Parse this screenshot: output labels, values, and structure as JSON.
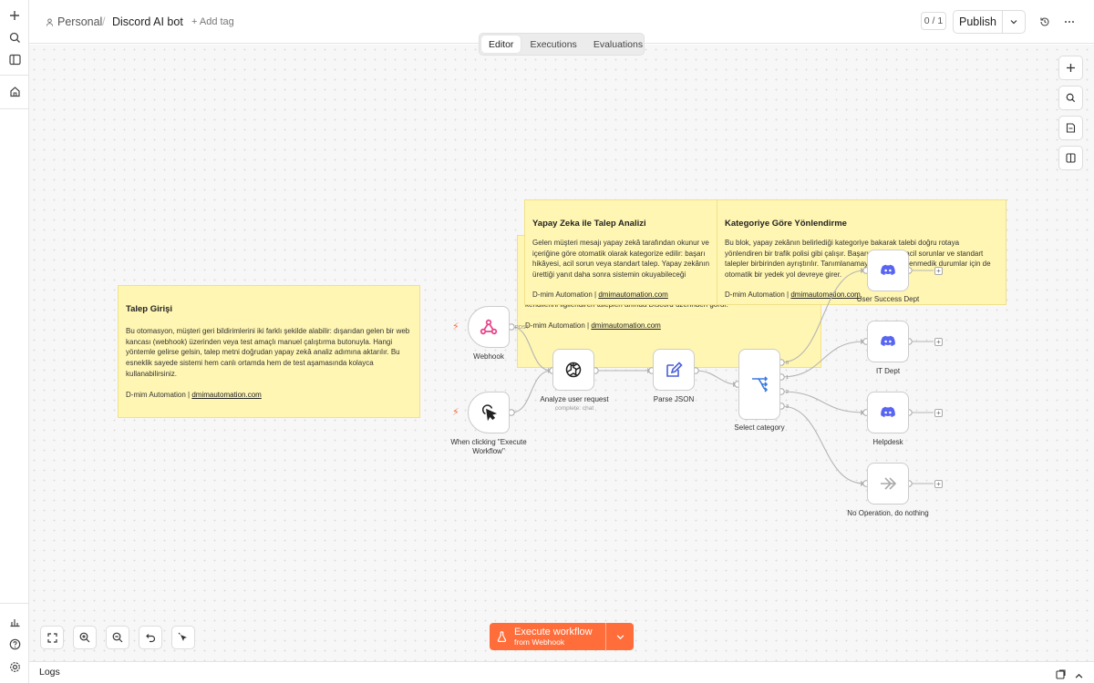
{
  "header": {
    "workspace": "Personal",
    "separator": "/",
    "workflow_name": "Discord AI bot",
    "add_tag": "+ Add tag",
    "counter": "0 / 1",
    "publish": "Publish"
  },
  "tabs": [
    "Editor",
    "Executions",
    "Evaluations"
  ],
  "sticky_notes": [
    {
      "title": "Talep Girişi",
      "body": "Bu otomasyon, müşteri geri bildirimlerini iki farklı şekilde alabilir: dışarıdan gelen bir web kancası (webhook) üzerinden veya test amaçlı manuel çalıştırma butonuyla. Hangi yöntemle gelirse gelsin, talep metni doğrudan yapay zekâ analiz adımına aktarılır. Bu esneklik sayede sistemi hem canlı ortamda hem de test aşamasında kolayca kullanabilirsiniz.",
      "footer": "D-mim Automation |",
      "link": "dmimautomation.com"
    },
    {
      "title": "Yapay Zeka ile Talep Analizi",
      "body": "Gelen müşteri mesajı yapay zekâ tarafından okunur ve içeriğine göre otomatik olarak kategorize edilir: başarı hikâyesi, acil sorun veya standart talep. Yapay zekânın ürettiği yanıt daha sonra sistemin okuyabileceği yapılandırılmış bir veriye dönüştürülür. Böylece hiçbir mesaj elle okunup sınıflandırılmak zorunda kalmaz.",
      "footer": "D-mim Automation |",
      "link": "dmimautomation.com"
    },
    {
      "title": "Kategoriye Göre Yönlendirme",
      "body": "Bu blok, yapay zekânın belirlediği kategoriye bakarak talebi doğru rotaya yönlendiren bir trafik polisi gibi çalışır. Başarı hikâyeleri, acil sorunlar ve standart talepler birbirinden ayrıştırılır. Tanımlanamayan veya beklenmedik durumlar için de otomatik bir yedek yol devreye girer.",
      "footer": "D-mim Automation |",
      "link": "dmimautomation.com"
    },
    {
      "body": "kendilerini ilgilendiren talepleri anında Discord üzerinden görür.",
      "footer": "D-mim Automation |",
      "link": "dmimautomation.com"
    }
  ],
  "nodes": {
    "webhook": {
      "label": "Webhook",
      "port_label": "POST",
      "icon": "webhook-icon"
    },
    "manual": {
      "label": "When clicking \"Execute Workflow\"",
      "icon": "pointer-click-icon"
    },
    "analyze": {
      "label": "Analyze user request",
      "sublabel": "complete: chat",
      "icon": "openai-icon"
    },
    "parse": {
      "label": "Parse JSON",
      "icon": "edit-icon"
    },
    "select": {
      "label": "Select category",
      "icon": "switch-icon",
      "outputs": [
        "0",
        "1",
        "2",
        "3"
      ]
    },
    "discord1": {
      "label": "User Success Dept",
      "icon": "discord-icon"
    },
    "discord2": {
      "label": "IT Dept",
      "icon": "discord-icon"
    },
    "discord3": {
      "label": "Helpdesk",
      "icon": "discord-icon"
    },
    "noop": {
      "label": "No Operation, do nothing",
      "icon": "arrow-right-icon"
    }
  },
  "execute": {
    "line1": "Execute workflow",
    "line2": "from Webhook"
  },
  "logs": "Logs",
  "colors": {
    "accent": "#ff6d3a",
    "sticky": "#fff6b3",
    "discord": "#5865f2",
    "webhook": "#e8468a"
  }
}
